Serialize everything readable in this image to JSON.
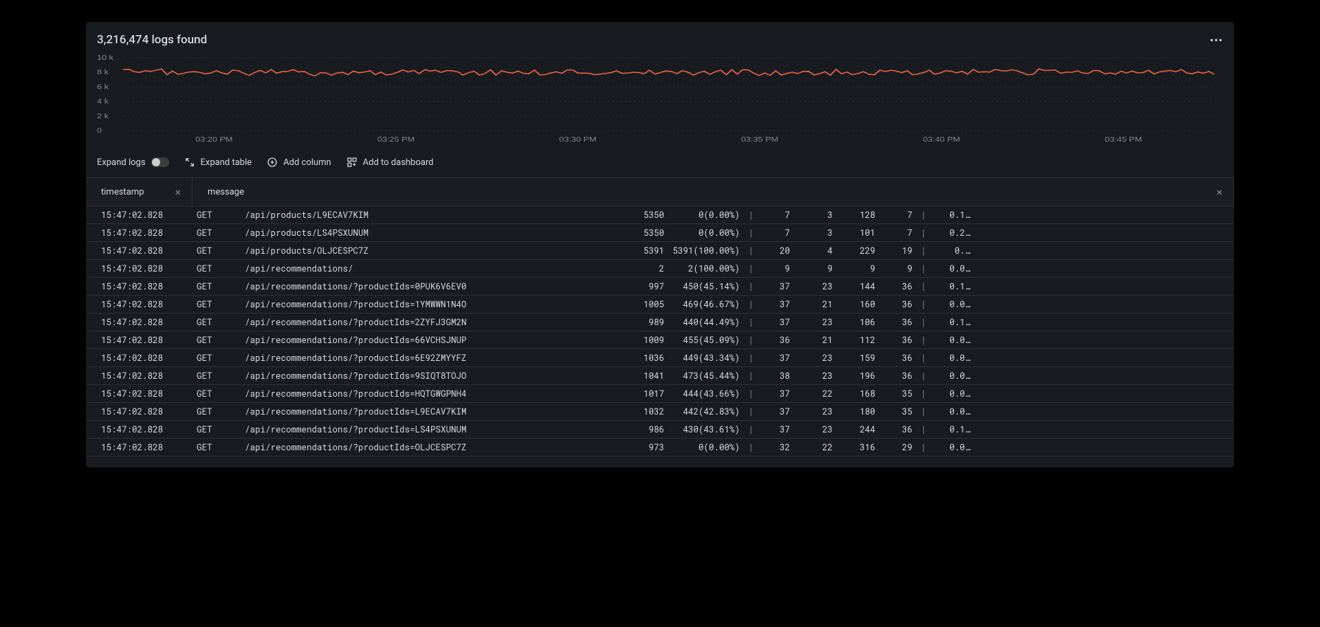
{
  "header": {
    "title": "3,216,474 logs found"
  },
  "chart_data": {
    "type": "line",
    "yticks": [
      "10 k",
      "8 k",
      "6 k",
      "4 k",
      "2 k",
      "0"
    ],
    "xticks": [
      "03:20 PM",
      "03:25 PM",
      "03:30 PM",
      "03:35 PM",
      "03:40 PM",
      "03:45 PM"
    ],
    "ylim": [
      0,
      10000
    ],
    "series": [
      {
        "name": "logs",
        "color": "#f2654a",
        "baseline": 8000,
        "jitter": 400
      }
    ]
  },
  "toolbar": {
    "expand_logs": "Expand logs",
    "expand_table": "Expand table",
    "add_column": "Add column",
    "add_dashboard": "Add to dashboard"
  },
  "columns": {
    "timestamp": "timestamp",
    "message": "message"
  },
  "rows": [
    {
      "ts": "15:47:02.828",
      "method": "GET",
      "path": "/api/products/L9ECAV7KIM",
      "c1": "5350",
      "c2": "0(0.00%)",
      "c3": "7",
      "c4": "3",
      "c5": "128",
      "c6": "7",
      "tail": "0.1…"
    },
    {
      "ts": "15:47:02.828",
      "method": "GET",
      "path": "/api/products/LS4PSXUNUM",
      "c1": "5350",
      "c2": "0(0.00%)",
      "c3": "7",
      "c4": "3",
      "c5": "101",
      "c6": "7",
      "tail": "0.2…"
    },
    {
      "ts": "15:47:02.828",
      "method": "GET",
      "path": "/api/products/OLJCESPC7Z",
      "c1": "5391",
      "c2": "5391(100.00%)",
      "c3": "20",
      "c4": "4",
      "c5": "229",
      "c6": "19",
      "tail": "0.…"
    },
    {
      "ts": "15:47:02.828",
      "method": "GET",
      "path": "/api/recommendations/",
      "c1": "2",
      "c2": "2(100.00%)",
      "c3": "9",
      "c4": "9",
      "c5": "9",
      "c6": "9",
      "tail": "0.0…"
    },
    {
      "ts": "15:47:02.828",
      "method": "GET",
      "path": "/api/recommendations/?productIds=0PUK6V6EV0",
      "c1": "997",
      "c2": "450(45.14%)",
      "c3": "37",
      "c4": "23",
      "c5": "144",
      "c6": "36",
      "tail": "0.1…"
    },
    {
      "ts": "15:47:02.828",
      "method": "GET",
      "path": "/api/recommendations/?productIds=1YMWWN1N4O",
      "c1": "1005",
      "c2": "469(46.67%)",
      "c3": "37",
      "c4": "21",
      "c5": "160",
      "c6": "36",
      "tail": "0.0…"
    },
    {
      "ts": "15:47:02.828",
      "method": "GET",
      "path": "/api/recommendations/?productIds=2ZYFJ3GM2N",
      "c1": "989",
      "c2": "440(44.49%)",
      "c3": "37",
      "c4": "23",
      "c5": "106",
      "c6": "36",
      "tail": "0.1…"
    },
    {
      "ts": "15:47:02.828",
      "method": "GET",
      "path": "/api/recommendations/?productIds=66VCHSJNUP",
      "c1": "1009",
      "c2": "455(45.09%)",
      "c3": "36",
      "c4": "21",
      "c5": "112",
      "c6": "36",
      "tail": "0.0…"
    },
    {
      "ts": "15:47:02.828",
      "method": "GET",
      "path": "/api/recommendations/?productIds=6E92ZMYYFZ",
      "c1": "1036",
      "c2": "449(43.34%)",
      "c3": "37",
      "c4": "23",
      "c5": "159",
      "c6": "36",
      "tail": "0.0…"
    },
    {
      "ts": "15:47:02.828",
      "method": "GET",
      "path": "/api/recommendations/?productIds=9SIQT8TOJO",
      "c1": "1041",
      "c2": "473(45.44%)",
      "c3": "38",
      "c4": "23",
      "c5": "196",
      "c6": "36",
      "tail": "0.0…"
    },
    {
      "ts": "15:47:02.828",
      "method": "GET",
      "path": "/api/recommendations/?productIds=HQTGWGPNH4",
      "c1": "1017",
      "c2": "444(43.66%)",
      "c3": "37",
      "c4": "22",
      "c5": "168",
      "c6": "35",
      "tail": "0.0…"
    },
    {
      "ts": "15:47:02.828",
      "method": "GET",
      "path": "/api/recommendations/?productIds=L9ECAV7KIM",
      "c1": "1032",
      "c2": "442(42.83%)",
      "c3": "37",
      "c4": "23",
      "c5": "180",
      "c6": "35",
      "tail": "0.0…"
    },
    {
      "ts": "15:47:02.828",
      "method": "GET",
      "path": "/api/recommendations/?productIds=LS4PSXUNUM",
      "c1": "986",
      "c2": "430(43.61%)",
      "c3": "37",
      "c4": "23",
      "c5": "244",
      "c6": "36",
      "tail": "0.1…"
    },
    {
      "ts": "15:47:02.828",
      "method": "GET",
      "path": "/api/recommendations/?productIds=OLJCESPC7Z",
      "c1": "973",
      "c2": "0(0.00%)",
      "c3": "32",
      "c4": "22",
      "c5": "316",
      "c6": "29",
      "tail": "0.0…"
    }
  ]
}
